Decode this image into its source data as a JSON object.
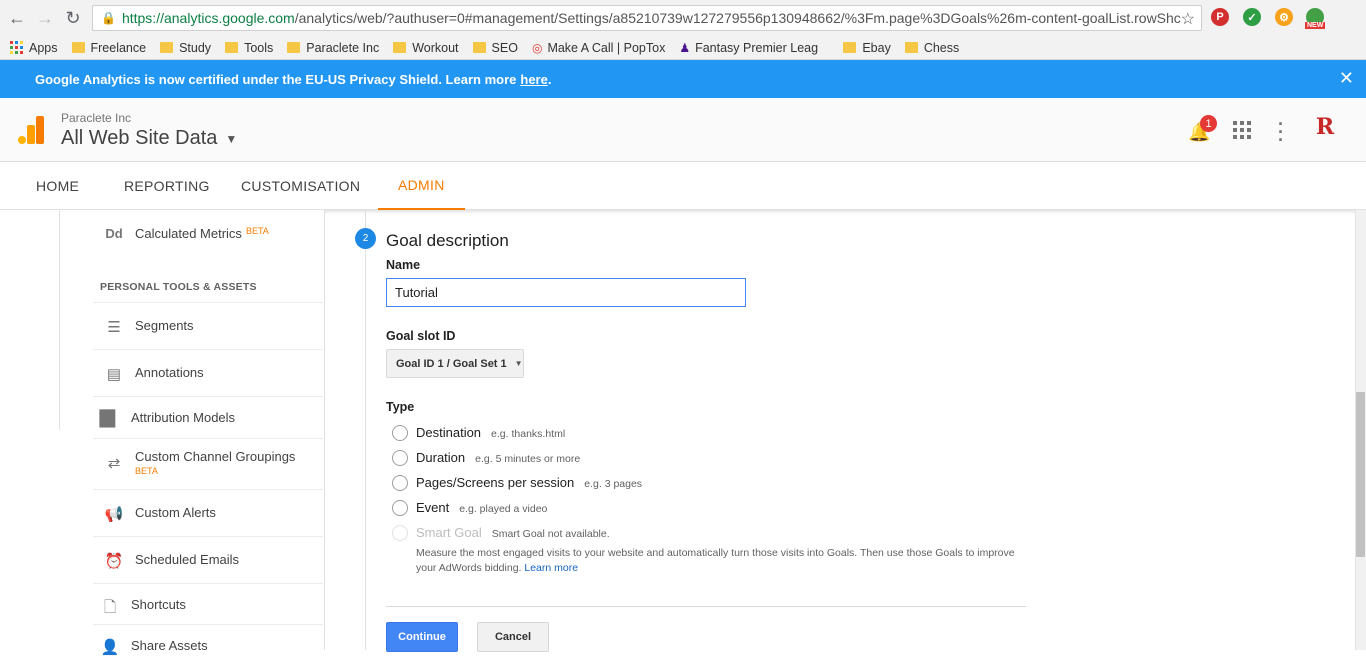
{
  "browser": {
    "url_secure": "https://analytics.google.com",
    "url_rest": "/analytics/web/?authuser=0#management/Settings/a85210739w127279556p130948662/%3Fm.page%3DGoals%26m-content-goalList.rowShc",
    "bookmarks": [
      "Apps",
      "Freelance",
      "Study",
      "Tools",
      "Paraclete Inc",
      "Workout",
      "SEO",
      "Make A Call | PopTox",
      "Fantasy Premier Leag",
      "Ebay",
      "Chess"
    ],
    "ext_badge": "NEW"
  },
  "banner": {
    "text": "Google Analytics is now certified under the EU-US Privacy Shield. Learn more",
    "link": "here",
    "after": ".",
    "close": "✕"
  },
  "header": {
    "account": "Paraclete Inc",
    "property": "All Web Site Data",
    "notifications": "1",
    "avatar": "R"
  },
  "nav": {
    "tabs": [
      "HOME",
      "REPORTING",
      "CUSTOMISATION",
      "ADMIN"
    ],
    "active": "ADMIN"
  },
  "sidebar": {
    "calc_metrics": "Calculated Metrics",
    "calc_metrics_badge": "BETA",
    "section": "PERSONAL TOOLS & ASSETS",
    "items": [
      "Segments",
      "Annotations",
      "Attribution Models",
      "Custom Channel Groupings",
      "Custom Alerts",
      "Scheduled Emails",
      "Shortcuts",
      "Share Assets"
    ],
    "ccg_badge": "BETA"
  },
  "form": {
    "step": "2",
    "title": "Goal description",
    "name_label": "Name",
    "name_value": "Tutorial",
    "slot_label": "Goal slot ID",
    "slot_value": "Goal ID 1 / Goal Set 1",
    "type_label": "Type",
    "types": [
      {
        "label": "Destination",
        "hint": "e.g. thanks.html"
      },
      {
        "label": "Duration",
        "hint": "e.g. 5 minutes or more"
      },
      {
        "label": "Pages/Screens per session",
        "hint": "e.g. 3 pages"
      },
      {
        "label": "Event",
        "hint": "e.g. played a video"
      },
      {
        "label": "Smart Goal",
        "hint": "Smart Goal not available."
      }
    ],
    "smart_desc": "Measure the most engaged visits to your website and automatically turn those visits into Goals. Then use those Goals to improve your AdWords bidding.",
    "smart_link": "Learn more",
    "continue": "Continue",
    "cancel": "Cancel"
  },
  "colors": {
    "accent": "#f57c00",
    "banner": "#2196f3",
    "primary_button": "#4285f4"
  }
}
